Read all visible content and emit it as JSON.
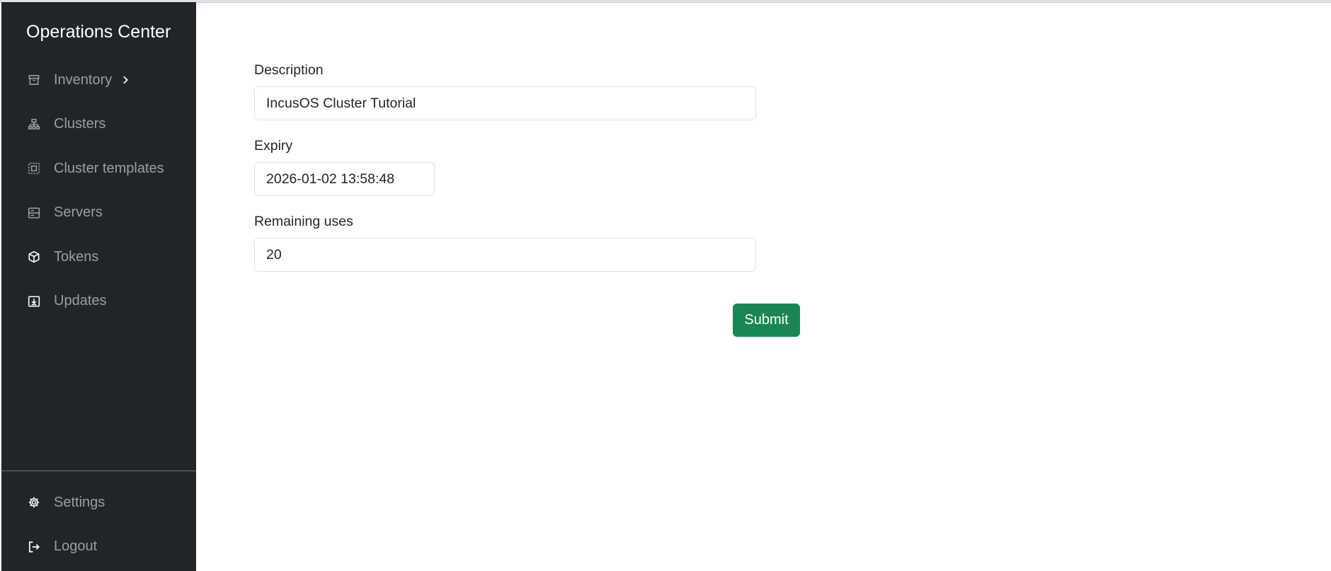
{
  "app": {
    "title": "Operations Center"
  },
  "sidebar": {
    "items": [
      {
        "label": "Inventory",
        "icon": "archive-icon",
        "has_submenu": true
      },
      {
        "label": "Clusters",
        "icon": "diagram-icon"
      },
      {
        "label": "Cluster templates",
        "icon": "template-icon"
      },
      {
        "label": "Servers",
        "icon": "server-icon"
      },
      {
        "label": "Tokens",
        "icon": "box-icon"
      },
      {
        "label": "Updates",
        "icon": "download-icon"
      }
    ],
    "bottom_items": [
      {
        "label": "Settings",
        "icon": "gear-icon"
      },
      {
        "label": "Logout",
        "icon": "logout-icon"
      }
    ]
  },
  "form": {
    "description": {
      "label": "Description",
      "value": "IncusOS Cluster Tutorial"
    },
    "expiry": {
      "label": "Expiry",
      "value": "2026-01-02 13:58:48"
    },
    "remaining_uses": {
      "label": "Remaining uses",
      "value": "20"
    },
    "submit_label": "Submit"
  },
  "colors": {
    "sidebar_bg": "#212529",
    "submit_bg": "#198754",
    "nav_text": "#8c8f92"
  }
}
